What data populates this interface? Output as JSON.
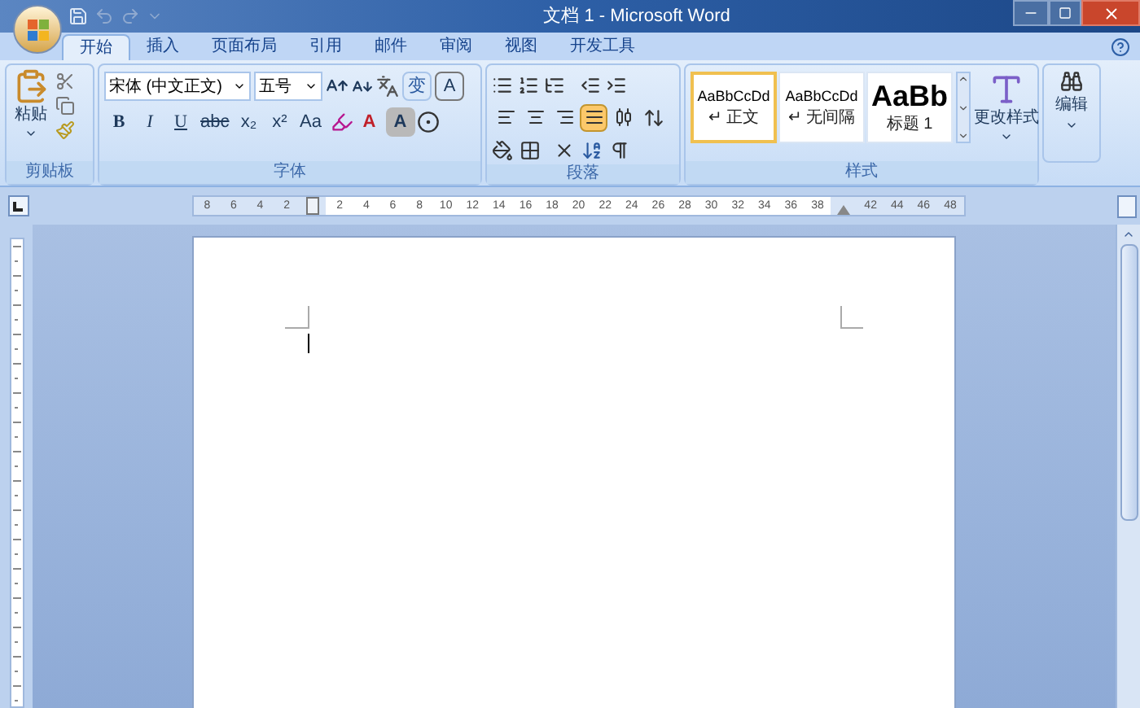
{
  "window": {
    "title": "文档 1 - Microsoft Word"
  },
  "tabs": [
    {
      "label": "开始",
      "selected": true
    },
    {
      "label": "插入",
      "selected": false
    },
    {
      "label": "页面布局",
      "selected": false
    },
    {
      "label": "引用",
      "selected": false
    },
    {
      "label": "邮件",
      "selected": false
    },
    {
      "label": "审阅",
      "selected": false
    },
    {
      "label": "视图",
      "selected": false
    },
    {
      "label": "开发工具",
      "selected": false
    }
  ],
  "clipboard": {
    "paste_label": "粘贴",
    "group_label": "剪贴板"
  },
  "font": {
    "font_name": "宋体 (中文正文)",
    "font_size": "五号",
    "row1_texts": [
      "变",
      "A"
    ],
    "row2_texts": [
      "B",
      "I",
      "U",
      "abc",
      "x₂",
      "x²",
      "Aa",
      "A",
      "A"
    ],
    "group_label": "字体"
  },
  "paragraph": {
    "align_buttons": [
      {
        "selected": false
      },
      {
        "selected": false
      },
      {
        "selected": false
      },
      {
        "selected": true
      },
      {
        "selected": false
      }
    ],
    "group_label": "段落"
  },
  "styles": {
    "items": [
      {
        "sample": "AaBbCcDd",
        "name": "↵ 正文",
        "kind": "normal",
        "selected": true
      },
      {
        "sample": "AaBbCcDd",
        "name": "↵ 无间隔",
        "kind": "normal",
        "selected": false
      },
      {
        "sample": "AaBb",
        "name": "标题 1",
        "kind": "heading",
        "selected": false
      }
    ],
    "change_label": "更改样式",
    "group_label": "样式"
  },
  "editing": {
    "label": "编辑"
  },
  "ruler": {
    "labels": [
      {
        "text": "8",
        "kind": "margin"
      },
      {
        "text": "6",
        "kind": "margin"
      },
      {
        "text": "4",
        "kind": "margin"
      },
      {
        "text": "2",
        "kind": "margin"
      },
      {
        "kind": "indent"
      },
      {
        "text": "2",
        "kind": "text"
      },
      {
        "text": "4",
        "kind": "text"
      },
      {
        "text": "6",
        "kind": "text"
      },
      {
        "text": "8",
        "kind": "text"
      },
      {
        "text": "10",
        "kind": "text"
      },
      {
        "text": "12",
        "kind": "text"
      },
      {
        "text": "14",
        "kind": "text"
      },
      {
        "text": "16",
        "kind": "text"
      },
      {
        "text": "18",
        "kind": "text"
      },
      {
        "text": "20",
        "kind": "text"
      },
      {
        "text": "22",
        "kind": "text"
      },
      {
        "text": "24",
        "kind": "text"
      },
      {
        "text": "26",
        "kind": "text"
      },
      {
        "text": "28",
        "kind": "text"
      },
      {
        "text": "30",
        "kind": "text"
      },
      {
        "text": "32",
        "kind": "text"
      },
      {
        "text": "34",
        "kind": "text"
      },
      {
        "text": "36",
        "kind": "text"
      },
      {
        "text": "38",
        "kind": "text"
      },
      {
        "kind": "right-indent"
      },
      {
        "text": "42",
        "kind": "margin"
      },
      {
        "text": "44",
        "kind": "margin"
      },
      {
        "text": "46",
        "kind": "margin"
      },
      {
        "text": "48",
        "kind": "margin"
      }
    ]
  }
}
